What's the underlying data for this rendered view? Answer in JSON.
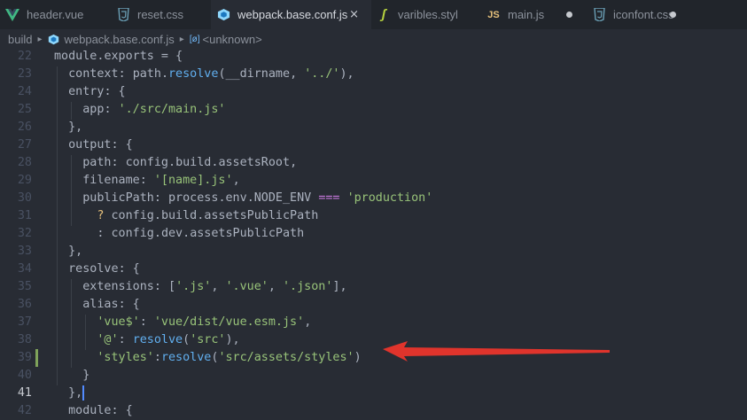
{
  "tabs": [
    {
      "label": "header.vue",
      "icon": "vue-icon",
      "state": ""
    },
    {
      "label": "reset.css",
      "icon": "css-file-icon",
      "state": ""
    },
    {
      "label": "webpack.base.conf.js",
      "icon": "webpack-icon",
      "state": "active"
    },
    {
      "label": "varibles.styl",
      "icon": "stylus-icon",
      "state": ""
    },
    {
      "label": "main.js",
      "icon": "js-icon",
      "state": "modified"
    },
    {
      "label": "iconfont.css",
      "icon": "css-file-icon",
      "state": "modified"
    }
  ],
  "tab_icons": {
    "js": "JS",
    "stylus": "ʃ"
  },
  "breadcrumb": {
    "folder": "build",
    "file": "webpack.base.conf.js",
    "symbol": "<unknown>",
    "symbol_icon": "[ø]"
  },
  "code_lines": [
    {
      "num": "22",
      "text": "module.exports = {"
    },
    {
      "num": "23",
      "text": "  context: path.resolve(__dirname, '../'),"
    },
    {
      "num": "24",
      "text": "  entry: {"
    },
    {
      "num": "25",
      "text": "    app: './src/main.js'"
    },
    {
      "num": "26",
      "text": "  },"
    },
    {
      "num": "27",
      "text": "  output: {"
    },
    {
      "num": "28",
      "text": "    path: config.build.assetsRoot,"
    },
    {
      "num": "29",
      "text": "    filename: '[name].js',"
    },
    {
      "num": "30",
      "text": "    publicPath: process.env.NODE_ENV === 'production'"
    },
    {
      "num": "31",
      "text": "      ? config.build.assetsPublicPath"
    },
    {
      "num": "32",
      "text": "      : config.dev.assetsPublicPath"
    },
    {
      "num": "33",
      "text": "  },"
    },
    {
      "num": "34",
      "text": "  resolve: {"
    },
    {
      "num": "35",
      "text": "    extensions: ['.js', '.vue', '.json'],"
    },
    {
      "num": "36",
      "text": "    alias: {"
    },
    {
      "num": "37",
      "text": "      'vue$': 'vue/dist/vue.esm.js',"
    },
    {
      "num": "38",
      "text": "      '@': resolve('src'),"
    },
    {
      "num": "39",
      "text": "      'styles':resolve('src/assets/styles')"
    },
    {
      "num": "40",
      "text": "    }"
    },
    {
      "num": "41",
      "text": "  },"
    },
    {
      "num": "42",
      "text": "  module: {"
    }
  ],
  "colors": {
    "background": "#282c34",
    "tabbar": "#21252b",
    "string": "#98c379",
    "function": "#61afef",
    "property": "#e06c75",
    "operator": "#56b6c2",
    "arrow": "#e0342c",
    "modified_marker": "#7fa35a"
  }
}
